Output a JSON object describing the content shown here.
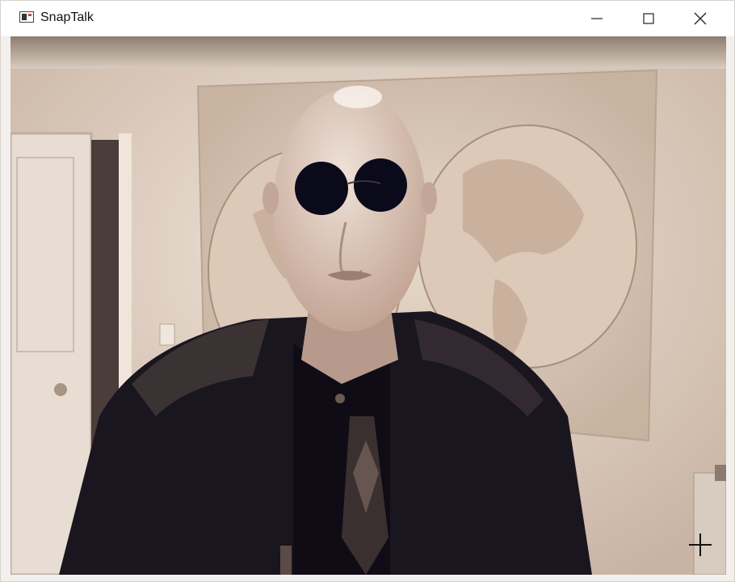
{
  "window": {
    "title": "SnapTalk",
    "controls": {
      "minimize": "minimize-icon",
      "maximize": "maximize-icon",
      "close": "close-icon"
    }
  },
  "video": {
    "overlay_effect": "sunglasses",
    "tint": "#c9b4a3",
    "cursor": "crosshair-icon"
  }
}
